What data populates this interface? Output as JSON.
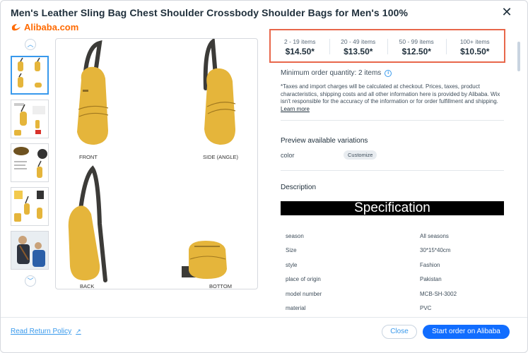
{
  "header": {
    "title": "Men's Leather Sling Bag Chest Shoulder Crossbody Shoulder Bags for Men's 100%",
    "close_icon": "close-icon",
    "brand": "Alibaba.com"
  },
  "gallery": {
    "up_icon": "chevron-up-icon",
    "down_icon": "chevron-down-icon",
    "labels": {
      "front": "FRONT",
      "side": "SIDE (ANGLE)",
      "back": "BACK",
      "bottom": "BOTTOM"
    },
    "colors": {
      "bag": "#e5b53b",
      "strap": "#3c3b38"
    }
  },
  "pricing": {
    "tiers": [
      {
        "range": "2 - 19 items",
        "price": "$14.50*"
      },
      {
        "range": "20 - 49 items",
        "price": "$13.50*"
      },
      {
        "range": "50 - 99 items",
        "price": "$12.50*"
      },
      {
        "range": "100+ items",
        "price": "$10.50*"
      }
    ],
    "highlight_color": "#e8674b"
  },
  "moq": {
    "text": "Minimum order quantity: 2 items",
    "icon": "info-icon"
  },
  "disclaimer": {
    "text": "*Taxes and import charges will be calculated at checkout. Prices, taxes, product characteristics, shipping costs and all other information here is provided by Alibaba. Wix isn't responsible for the accuracy of the information or for order fulfillment and shipping.",
    "link": "Learn more"
  },
  "variations": {
    "title": "Preview available variations",
    "label": "color",
    "chip": "Customize"
  },
  "description": {
    "title": "Description",
    "banner": "Specification",
    "specs": [
      {
        "key": "season",
        "value": "All seasons"
      },
      {
        "key": "Size",
        "value": "30*15*40cm"
      },
      {
        "key": "style",
        "value": "Fashion"
      },
      {
        "key": "place of origin",
        "value": "Pakistan"
      },
      {
        "key": "model number",
        "value": "MCB-SH-3002"
      },
      {
        "key": "material",
        "value": "PVC"
      }
    ]
  },
  "footer": {
    "return_link": "Read Return Policy",
    "close_label": "Close",
    "primary_label": "Start order on Alibaba",
    "primary_color": "#116dff"
  }
}
